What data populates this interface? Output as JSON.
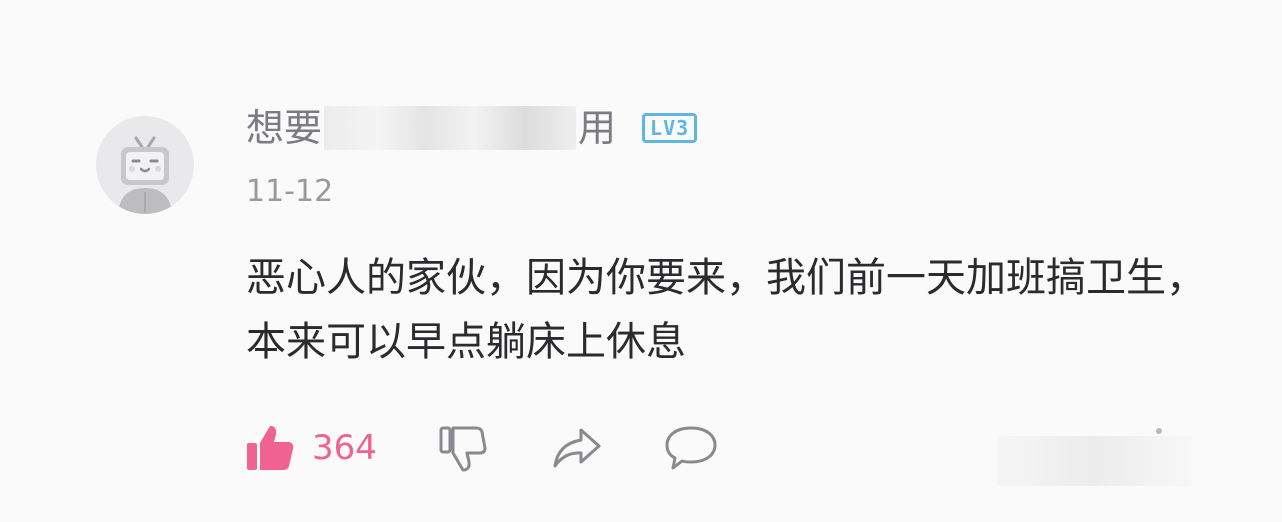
{
  "comment": {
    "avatar_icon": "tv-mascot-icon",
    "username_prefix": "想要",
    "username_suffix": "用",
    "level_badge": "LV3",
    "date": "11-12",
    "content": "恶心人的家伙，因为你要来，我们前一天加班搞卫生，本来可以早点躺床上休息",
    "actions": {
      "like_icon": "thumbs-up-filled-icon",
      "like_count": "364",
      "dislike_icon": "thumbs-down-icon",
      "share_icon": "share-arrow-icon",
      "reply_icon": "speech-bubble-icon"
    }
  },
  "colors": {
    "accent_pink": "#f06292",
    "level_blue": "#5fb6e2",
    "text_dark": "#2b2b2d",
    "text_gray": "#9a9a9e",
    "icon_gray": "#8a8a8e"
  }
}
